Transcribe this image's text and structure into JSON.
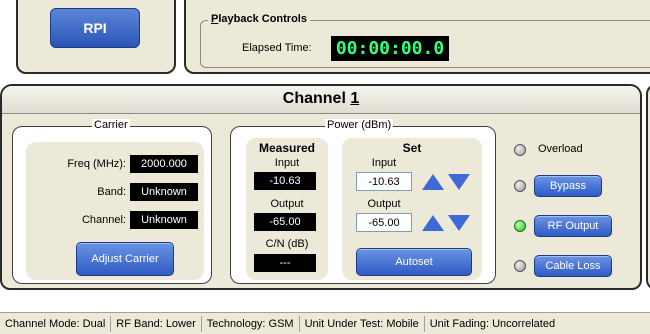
{
  "rpi": {
    "label": "RPI"
  },
  "playback": {
    "title_accel": "P",
    "title_rest": "layback Controls",
    "elapsed_label": "Elapsed Time:",
    "elapsed_value": "00:00:00.0"
  },
  "channel": {
    "title_prefix": "Channel ",
    "number": "1",
    "carrier": {
      "legend": "Carrier",
      "freq_label": "Freq (MHz):",
      "freq_value": "2000.000",
      "band_label": "Band:",
      "band_value": "Unknown",
      "channel_label": "Channel:",
      "channel_value": "Unknown",
      "adjust_button": "Adjust Carrier"
    },
    "power": {
      "legend": "Power (dBm)",
      "measured": {
        "heading": "Measured",
        "input_label": "Input",
        "input_value": "-10.63",
        "output_label": "Output",
        "output_value": "-65.00",
        "cn_label": "C/N (dB)",
        "cn_value": "---"
      },
      "set": {
        "heading": "Set",
        "input_label": "Input",
        "input_value": "-10.63",
        "output_label": "Output",
        "output_value": "-65.00",
        "autoset_button": "Autoset"
      }
    },
    "indicators": {
      "overload_label": "Overload",
      "bypass_label": "Bypass",
      "rf_output_label": "RF Output",
      "cable_loss_label": "Cable Loss"
    }
  },
  "status_bar": [
    "Channel Mode: Dual",
    "RF Band: Lower",
    "Technology: GSM",
    "Unit Under Test: Mobile",
    "Unit Fading: Uncorrelated"
  ],
  "colors": {
    "panel_bg": "#ece9d8",
    "button_blue": "#2f5bc4",
    "elapsed_green": "#32ff7a",
    "led_on": "#16c416"
  }
}
